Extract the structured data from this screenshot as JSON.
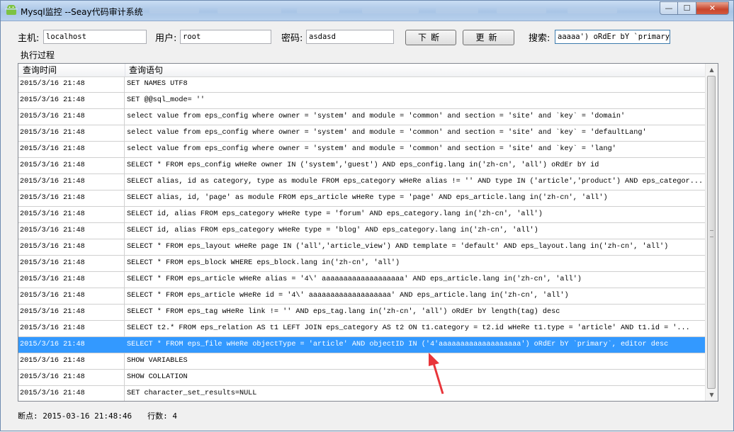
{
  "window": {
    "title": "Mysql监控 --Seay代码审计系统",
    "buttons": {
      "minimize": "—",
      "maximize": "☐",
      "close": "✕"
    }
  },
  "toolbar": {
    "host_label": "主机:",
    "host_value": "localhost",
    "user_label": "用户:",
    "user_value": "root",
    "password_label": "密码:",
    "password_value": "asdasd",
    "break_button": "下断",
    "update_button": "更新",
    "search_label": "搜索:",
    "search_value": "aaaaa') oRdEr bY `primary`"
  },
  "group_label": "执行过程",
  "list": {
    "columns": [
      "查询时间",
      "查询语句"
    ],
    "rows": [
      {
        "time": "2015/3/16 21:48",
        "query": "SET NAMES UTF8"
      },
      {
        "time": "2015/3/16 21:48",
        "query": "SET @@sql_mode= ''"
      },
      {
        "time": "2015/3/16 21:48",
        "query": "select value from eps_config where owner = 'system' and module = 'common' and section = 'site' and `key` = 'domain'"
      },
      {
        "time": "2015/3/16 21:48",
        "query": "select value from eps_config where owner = 'system' and module = 'common' and section = 'site' and `key` = 'defaultLang'"
      },
      {
        "time": "2015/3/16 21:48",
        "query": "select value from eps_config where owner = 'system' and module = 'common' and section = 'site' and `key` = 'lang'"
      },
      {
        "time": "2015/3/16 21:48",
        "query": "SELECT * FROM eps_config wHeRe owner IN ('system','guest')  AND  eps_config.lang in('zh-cn', 'all')  oRdEr bY id"
      },
      {
        "time": "2015/3/16 21:48",
        "query": "SELECT alias, id as category, type as module FROM eps_category wHeRe alias  != '' AND type IN ('article','product') AND  eps_categor..."
      },
      {
        "time": "2015/3/16 21:48",
        "query": "SELECT alias, id, 'page' as module FROM eps_article wHeRe type  = 'page' AND  eps_article.lang in('zh-cn', 'all')"
      },
      {
        "time": "2015/3/16 21:48",
        "query": "SELECT id, alias FROM eps_category wHeRe type  = 'forum' AND  eps_category.lang in('zh-cn', 'all')"
      },
      {
        "time": "2015/3/16 21:48",
        "query": "SELECT id, alias FROM eps_category wHeRe type  = 'blog' AND  eps_category.lang in('zh-cn', 'all')"
      },
      {
        "time": "2015/3/16 21:48",
        "query": "SELECT * FROM eps_layout wHeRe page IN ('all','article_view') AND template  = 'default' AND  eps_layout.lang in('zh-cn', 'all')"
      },
      {
        "time": "2015/3/16 21:48",
        "query": "SELECT * FROM eps_block WHERE  eps_block.lang in('zh-cn', 'all')"
      },
      {
        "time": "2015/3/16 21:48",
        "query": "SELECT * FROM eps_article wHeRe alias  = '4\\' aaaaaaaaaaaaaaaaaaa' AND  eps_article.lang in('zh-cn', 'all')"
      },
      {
        "time": "2015/3/16 21:48",
        "query": "SELECT * FROM eps_article wHeRe id  = '4\\' aaaaaaaaaaaaaaaaaaa' AND  eps_article.lang in('zh-cn', 'all')"
      },
      {
        "time": "2015/3/16 21:48",
        "query": "SELECT * FROM eps_tag wHeRe link  != ''  AND  eps_tag.lang in('zh-cn', 'all')  oRdEr bY length(tag) desc"
      },
      {
        "time": "2015/3/16 21:48",
        "query": "SELECT t2.* FROM eps_relation AS t1  LEFT JOIN eps_category AS t2  ON t1.category = t2.id  wHeRe t1.type  = 'article' AND t1.id  = '..."
      },
      {
        "time": "2015/3/16 21:48",
        "query": "SELECT * FROM eps_file wHeRe objectType  = 'article' AND objectID IN ('4'aaaaaaaaaaaaaaaaaaa') oRdEr bY `primary`, editor desc",
        "selected": true
      },
      {
        "time": "2015/3/16 21:48",
        "query": "SHOW VARIABLES"
      },
      {
        "time": "2015/3/16 21:48",
        "query": "SHOW COLLATION"
      },
      {
        "time": "2015/3/16 21:48",
        "query": "SET character_set_results=NULL"
      }
    ]
  },
  "status": {
    "breakpoint": "断点: 2015-03-16 21:48:46",
    "row_count": "行数: 4"
  },
  "colors": {
    "selection": "#3399ff",
    "annotation_arrow": "#e8353a"
  }
}
